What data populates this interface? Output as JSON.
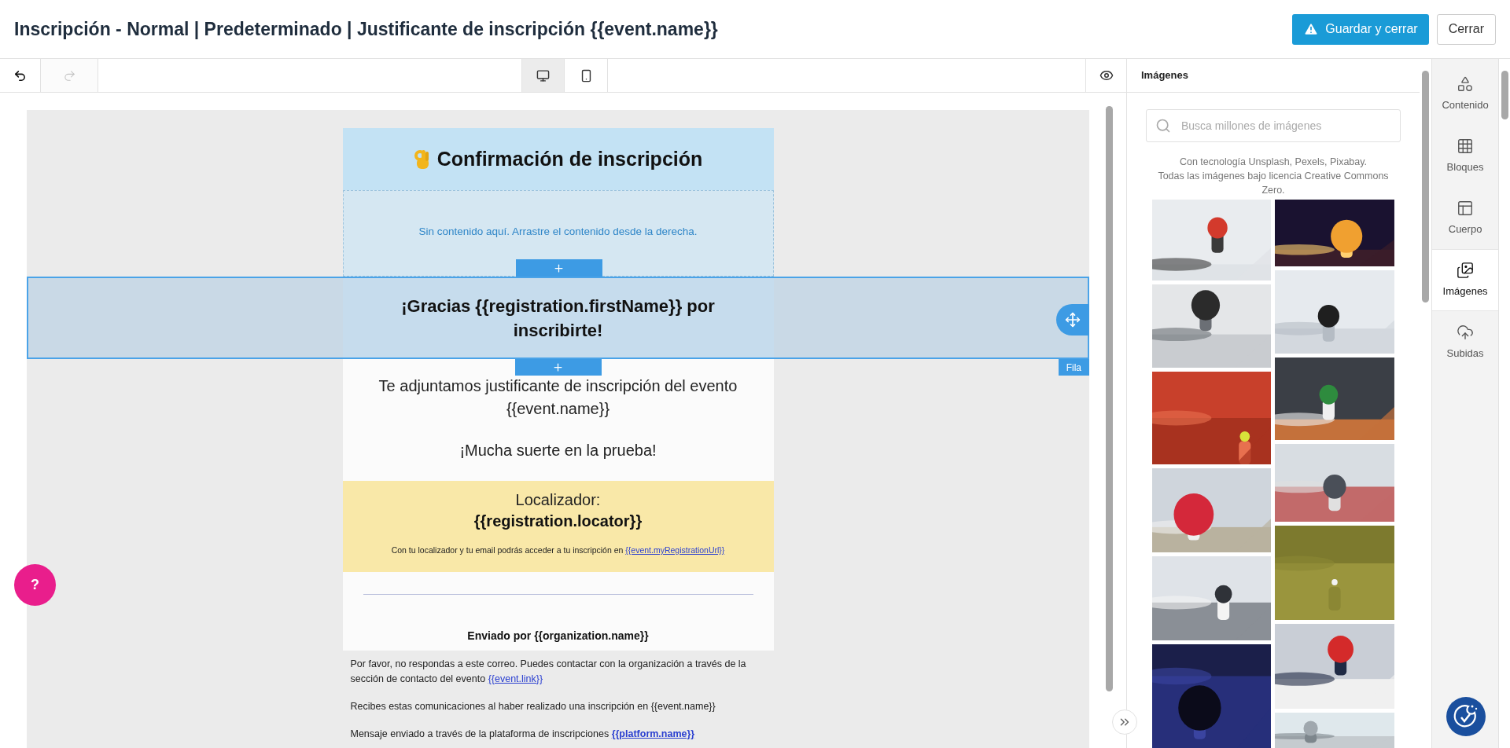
{
  "header": {
    "title": "Inscripción - Normal | Predeterminado | Justificante de inscripción {{event.name}}",
    "buttons": [
      {
        "label": "Guardar y cerrar",
        "kind": "primary"
      },
      {
        "label": "Cerrar",
        "kind": "secondary"
      }
    ]
  },
  "toolbar": {
    "history": [
      {
        "kind": "undo",
        "disabled": false
      },
      {
        "kind": "redo",
        "disabled": true
      }
    ],
    "devices": [
      {
        "kind": "desktop",
        "selected": true
      },
      {
        "kind": "mobile",
        "selected": false
      }
    ]
  },
  "email": {
    "title": "Confirmación de inscripción",
    "empty_hint": "Sin contenido aquí. Arrastre el contenido desde la derecha.",
    "selected_row": {
      "text": "¡Gracias {{registration.firstName}} por inscribirte!",
      "tag": "Fila"
    },
    "body": [
      "Te adjuntamos justificante de inscripción del evento {{event.name}}",
      "¡Mucha suerte en la prueba!"
    ],
    "locator": {
      "label": "Localizador:",
      "value": "{{registration.locator}}",
      "note": "Con tu localizador y tu email podrás acceder a tu inscripción en ",
      "link": "{{event.myRegistrationUrl}}"
    },
    "sender": "Enviado por {{organization.name}}",
    "footer": [
      {
        "text": "Por favor, no respondas a este correo. Puedes contactar con la organización a través de la sección de contacto del evento ",
        "link": "{{event.link}}",
        "link_bold": false
      },
      {
        "text": "Recibes estas comunicaciones al haber realizado una inscripción en {{event.name}}"
      },
      {
        "text": "Mensaje enviado a través de la plataforma de inscripciones ",
        "link": "{{platform.name}}",
        "link_bold": true
      }
    ]
  },
  "help_button": "?",
  "images_panel": {
    "title": "Imágenes",
    "search": {
      "placeholder": "Busca millones de imágenes"
    },
    "credit": [
      "Con tecnología Unsplash, Pexels, Pixabay.",
      "Todas las imágenes bajo licencia Creative Commons Zero."
    ]
  },
  "sidebar": {
    "tabs": [
      {
        "label": "Contenido",
        "kind": "content",
        "selected": false
      },
      {
        "label": "Bloques",
        "kind": "blocks",
        "selected": false
      },
      {
        "label": "Cuerpo",
        "kind": "body",
        "selected": false
      },
      {
        "label": "Imágenes",
        "kind": "images",
        "selected": true
      },
      {
        "label": "Subidas",
        "kind": "uploads",
        "selected": false
      }
    ]
  }
}
